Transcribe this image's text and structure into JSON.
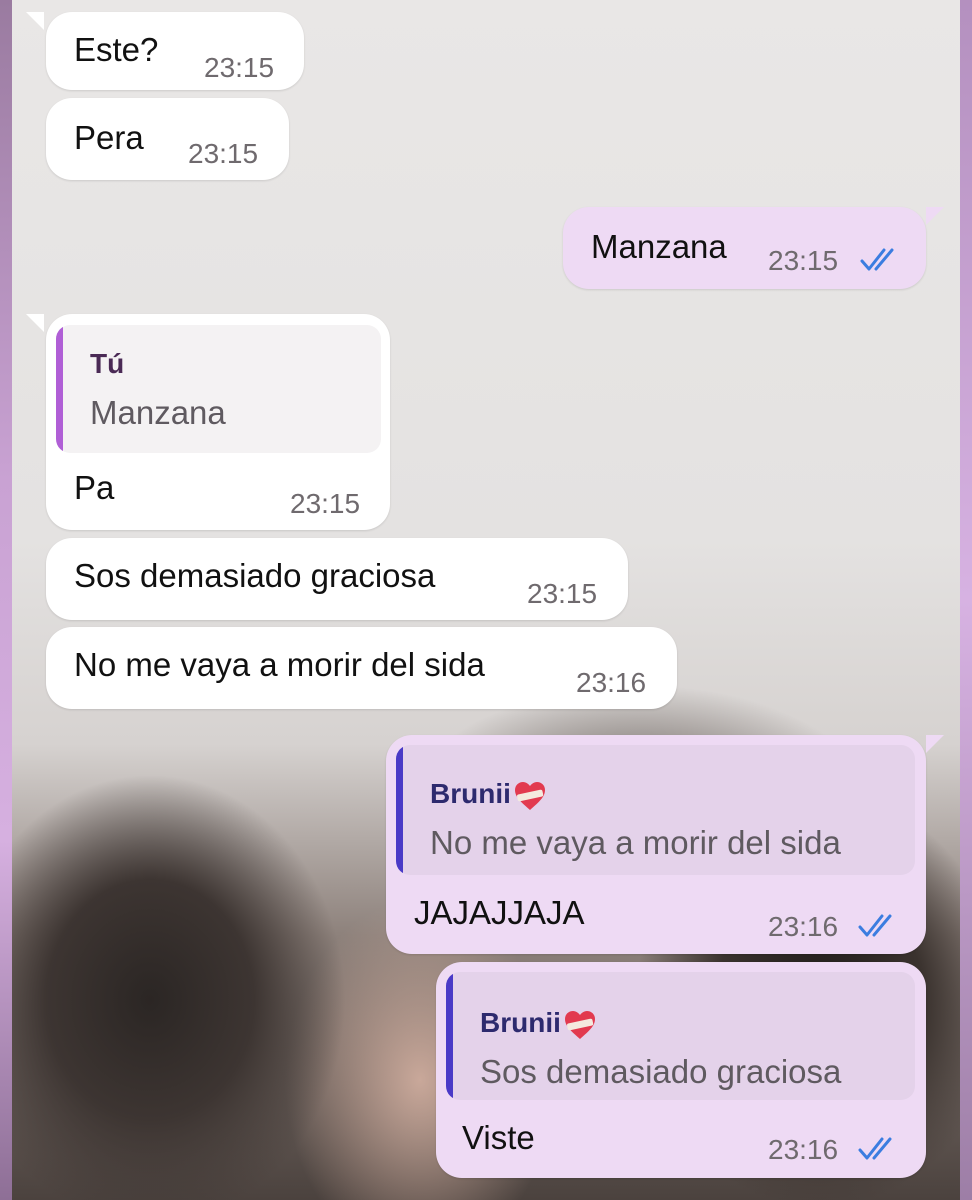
{
  "colors": {
    "incoming_bubble": "#ffffff",
    "outgoing_bubble": "#eedaf4",
    "read_ticks": "#3b7de0",
    "quote_bar_you": "#b05fd6",
    "quote_bar_contact": "#4a3ac7",
    "quote_author_you": "#4a2a55",
    "quote_author_contact": "#2d2a6e"
  },
  "messages": [
    {
      "direction": "in",
      "text": "Este?",
      "time": "23:15"
    },
    {
      "direction": "in",
      "text": "Pera",
      "time": "23:15"
    },
    {
      "direction": "out",
      "text": "Manzana",
      "time": "23:15",
      "status_icon": "double-check-icon"
    },
    {
      "direction": "in",
      "reply_to": {
        "author": "Tú",
        "text": "Manzana"
      },
      "text": "Pa",
      "time": "23:15"
    },
    {
      "direction": "in",
      "text": "Sos demasiado graciosa",
      "time": "23:15"
    },
    {
      "direction": "in",
      "text": "No me vaya a morir del sida",
      "time": "23:16"
    },
    {
      "direction": "out",
      "reply_to": {
        "author": "Brunii",
        "author_icon": "mending-heart-emoji",
        "text": "No me vaya a morir del sida"
      },
      "text": "JAJAJJAJA",
      "time": "23:16",
      "status_icon": "double-check-icon"
    },
    {
      "direction": "out",
      "reply_to": {
        "author": "Brunii",
        "author_icon": "mending-heart-emoji",
        "text": "Sos demasiado graciosa"
      },
      "text": "Viste",
      "time": "23:16",
      "status_icon": "double-check-icon"
    }
  ]
}
